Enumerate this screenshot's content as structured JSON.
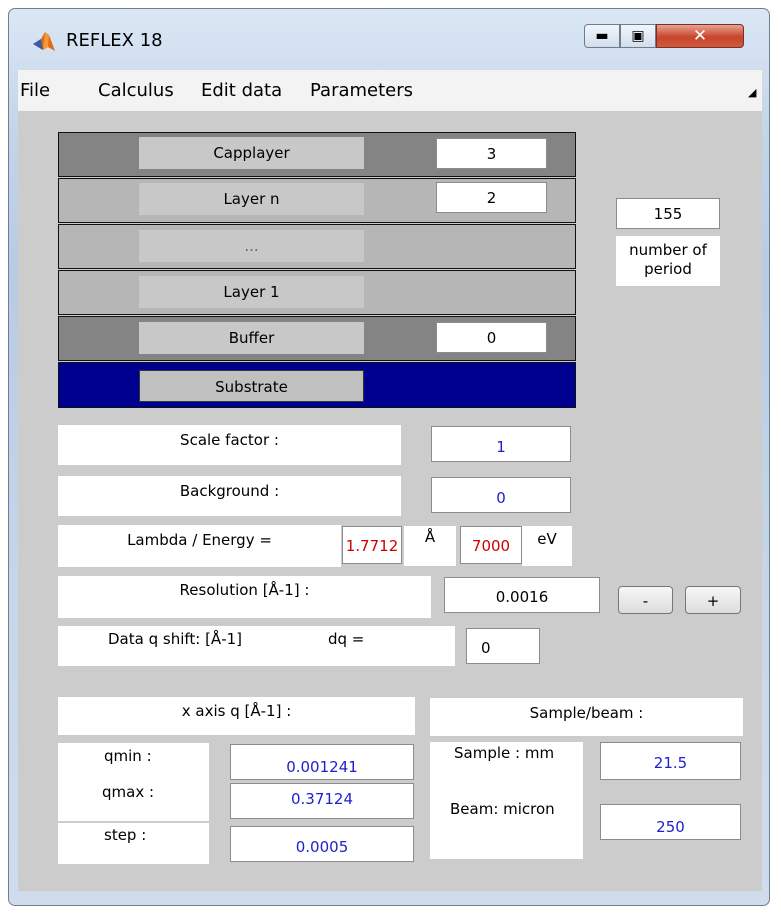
{
  "window": {
    "title": "REFLEX 18"
  },
  "menu": {
    "file": "File",
    "calculus": "Calculus",
    "edit_data": "Edit data",
    "parameters": "Parameters"
  },
  "layers": {
    "capplayer": {
      "label": "Capplayer",
      "value": "3"
    },
    "layer_n": {
      "label": "Layer n",
      "value": "2"
    },
    "ellipsis": {
      "label": "..."
    },
    "layer_1": {
      "label": "Layer 1"
    },
    "buffer": {
      "label": "Buffer",
      "value": "0"
    },
    "substrate": {
      "label": "Substrate"
    }
  },
  "period": {
    "value": "155",
    "label_line1": "number of",
    "label_line2": "period"
  },
  "scale_factor": {
    "label": "Scale factor :",
    "value": "1"
  },
  "background": {
    "label": "Background :",
    "value": "0"
  },
  "lambda_energy": {
    "label": "Lambda / Energy =",
    "lambda": "1.7712",
    "lambda_unit": "Å",
    "energy": "7000",
    "energy_unit": "eV"
  },
  "resolution": {
    "label": "Resolution [Å-1] :",
    "value": "0.0016",
    "minus": "-",
    "plus": "+"
  },
  "q_shift": {
    "label": "Data q shift: [Å-1]",
    "dq_label": "dq =",
    "value": "0"
  },
  "x_axis": {
    "label": "x axis q [Å-1] :",
    "qmin_label": "qmin :",
    "qmin": "0.001241",
    "qmax_label": "qmax :",
    "qmax": "0.37124",
    "step_label": "step :",
    "step": "0.0005"
  },
  "sample_beam": {
    "label": "Sample/beam :",
    "sample_label": "Sample : mm",
    "sample": "21.5",
    "beam_label": "Beam: micron",
    "beam": "250"
  }
}
